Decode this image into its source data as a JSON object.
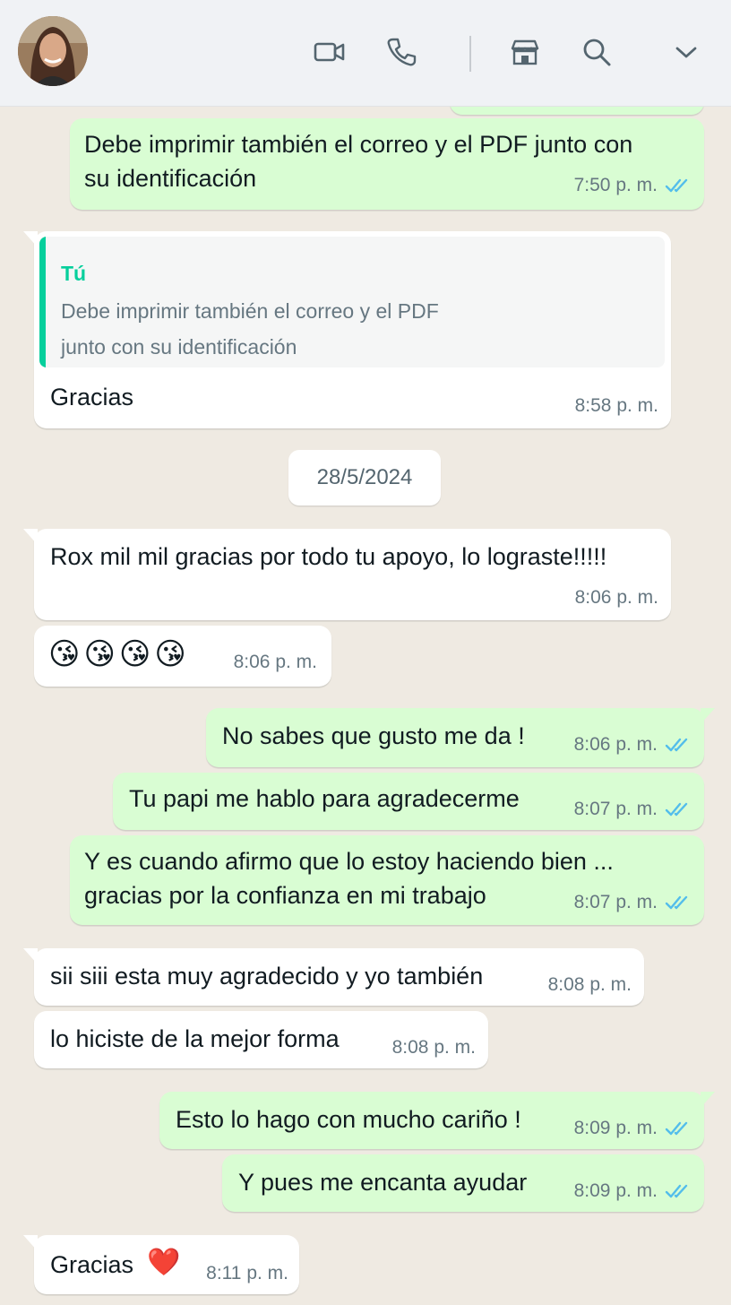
{
  "header": {
    "contact_name": "",
    "icons": [
      "video-call-icon",
      "phone-icon",
      "store-icon",
      "search-icon",
      "chevron-down-icon"
    ]
  },
  "colors": {
    "incoming": "#ffffff",
    "outgoing": "#d9fdd3",
    "chat_bg": "#efeae2",
    "read_ticks": "#53bdeb",
    "quote_accent": "#06cf9c"
  },
  "messages": {
    "m1": {
      "line1": "Debe imprimir también el correo y el PDF junto con",
      "line2": "su identificación",
      "time": "7:50 p. m."
    },
    "m2": {
      "quote_author": "Tú",
      "quote_line1": "Debe imprimir también el correo y el PDF",
      "quote_line2": "junto con su identificación",
      "text": "Gracias",
      "time": "8:58 p. m."
    },
    "date": "28/5/2024",
    "m3": {
      "text": "Rox mil mil gracias por todo tu apoyo, lo lograste!!!!!",
      "time": "8:06 p. m."
    },
    "m4": {
      "text": "😘😘😘😘",
      "time": "8:06 p. m."
    },
    "m5": {
      "text": "No sabes que gusto me da !",
      "time": "8:06 p. m."
    },
    "m6": {
      "text": "Tu papi me hablo para agradecerme",
      "time": "8:07 p. m."
    },
    "m7": {
      "line1": "Y es cuando afirmo que lo estoy haciendo bien ...",
      "line2": "gracias por la confianza en mi trabajo",
      "time": "8:07 p. m."
    },
    "m8": {
      "text": "sii siii esta muy agradecido y yo también",
      "time": "8:08 p. m."
    },
    "m9": {
      "text": "lo hiciste de la mejor forma",
      "time": "8:08 p. m."
    },
    "m10": {
      "text": "Esto lo hago con mucho cariño !",
      "time": "8:09 p. m."
    },
    "m11": {
      "text": "Y pues me encanta ayudar",
      "time": "8:09 p. m."
    },
    "m12": {
      "text": "Gracias",
      "emoji": "❤️",
      "time": "8:11 p. m."
    }
  }
}
